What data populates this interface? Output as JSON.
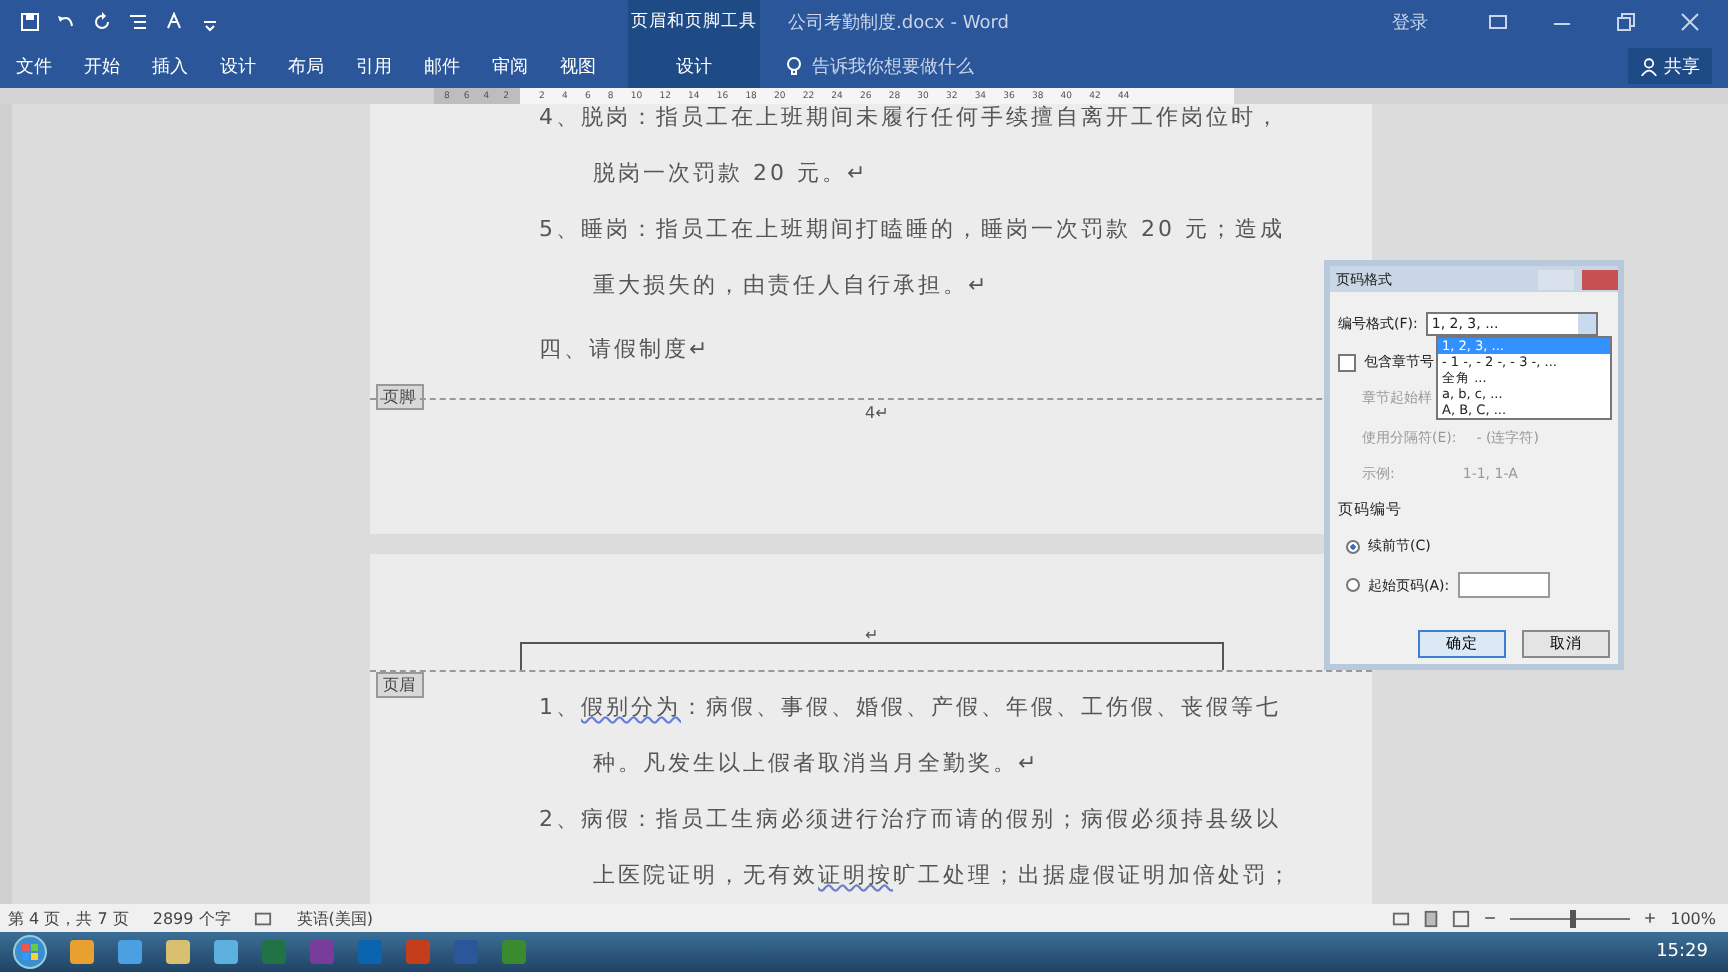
{
  "title_bar": {
    "context_group": "页眉和页脚工具",
    "document_title": "公司考勤制度.docx - Word",
    "sign_in": "登录"
  },
  "ribbon_tabs": [
    {
      "label": "文件",
      "selected": false
    },
    {
      "label": "开始",
      "selected": false
    },
    {
      "label": "插入",
      "selected": false
    },
    {
      "label": "设计",
      "selected": false
    },
    {
      "label": "布局",
      "selected": false
    },
    {
      "label": "引用",
      "selected": false
    },
    {
      "label": "邮件",
      "selected": false
    },
    {
      "label": "审阅",
      "selected": false
    },
    {
      "label": "视图",
      "selected": false
    },
    {
      "label": "设计",
      "selected": true
    }
  ],
  "tell_me": {
    "placeholder": "告诉我你想要做什么"
  },
  "share_button": "共享",
  "ruler": {
    "left_ticks": [
      "8",
      "6",
      "4",
      "2"
    ],
    "ticks": [
      "2",
      "4",
      "6",
      "8",
      "10",
      "12",
      "14",
      "16",
      "18",
      "20",
      "22",
      "24",
      "26",
      "28",
      "30",
      "32",
      "34",
      "36",
      "38",
      "40",
      "42",
      "44"
    ]
  },
  "page_1": {
    "lines": [
      {
        "kind": "item",
        "text": "4、脱岗：指员工在上班期间未履行任何手续擅自离开工作岗位时，"
      },
      {
        "kind": "indent",
        "text": "脱岗一次罚款 20 元。↵"
      },
      {
        "kind": "item",
        "text": "5、睡岗：指员工在上班期间打瞌睡的，睡岗一次罚款 20 元；造成"
      },
      {
        "kind": "indent",
        "text": "重大损失的，由责任人自行承担。↵"
      },
      {
        "kind": "heading",
        "text": "四、请假制度↵"
      }
    ],
    "footer_tag": "页脚",
    "footer_text": "4↵"
  },
  "page_2": {
    "header_text": "↵",
    "header_tag": "页眉",
    "lines": [
      {
        "kind": "item",
        "text": "1、**假别分为**：病假、事假、婚假、产假、年假、工伤假、丧假等七"
      },
      {
        "kind": "indent",
        "text": "种。凡发生以上假者取消当月全勤奖。↵"
      },
      {
        "kind": "item",
        "text": "2、病假：指员工生病必须进行治疗而请的假别；病假必须持县级以"
      },
      {
        "kind": "indent",
        "text": "上医院证明，无有效**证明按**旷工处理；出据虚假证明加倍处罚；"
      }
    ]
  },
  "dialog": {
    "title": "页码格式",
    "format_label": "编号格式(F):",
    "format_value": "1, 2, 3, ...",
    "format_options": [
      {
        "label": "1, 2, 3, ...",
        "selected": true
      },
      {
        "label": "- 1 -, - 2 -, - 3 -, ...",
        "selected": false
      },
      {
        "label": "全角 ...",
        "selected": false
      },
      {
        "label": "a, b, c, ...",
        "selected": false
      },
      {
        "label": "A, B, C, ...",
        "selected": false
      }
    ],
    "include_chapter": {
      "label": "包含章节号",
      "checked": false
    },
    "chapter_style_label": "章节起始样",
    "separator_label": "使用分隔符(E):",
    "separator_value": "-   (连字符)",
    "example_label": "示例:",
    "example_value": "1-1, 1-A",
    "numbering_heading": "页码编号",
    "numbering_options": [
      {
        "label": "续前节(C)",
        "selected": true
      },
      {
        "label": "起始页码(A):",
        "selected": false
      }
    ],
    "buttons": [
      "确定",
      "取消"
    ]
  },
  "status_bar": {
    "page": "第 4 页，共 7 页",
    "words": "2899 个字",
    "language": "英语(美国)",
    "zoom": {
      "level": 0.5
    },
    "zoom_text": "100%"
  },
  "taskbar": {
    "time": "15:29"
  }
}
